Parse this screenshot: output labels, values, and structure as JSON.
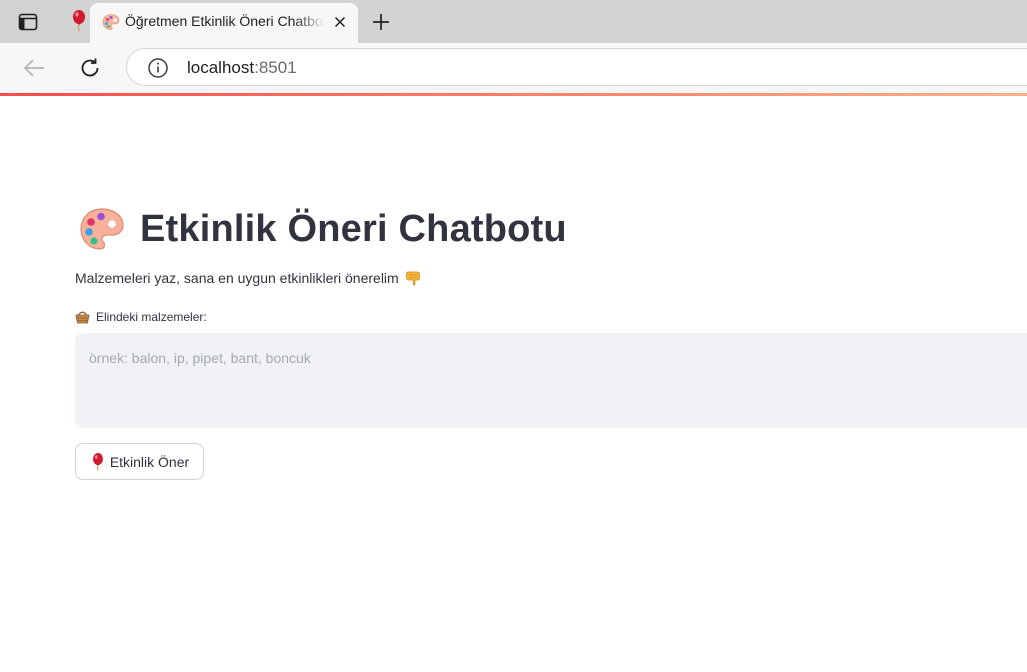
{
  "browser": {
    "tab": {
      "title": "Öğretmen Etkinlik Öneri Chatbotu"
    },
    "address": {
      "host": "localhost",
      "port": ":8501"
    }
  },
  "page": {
    "title": "Etkinlik Öneri Chatbotu",
    "subtitle": "Malzemeleri yaz, sana en uygun etkinlikleri önerelim",
    "input": {
      "label": "Elindeki malzemeler:",
      "placeholder": "örnek: balon, ip, pipet, bant, boncuk",
      "value": ""
    },
    "button": {
      "label": "Etkinlik Öner"
    }
  },
  "icons": {
    "sidebar": "sidebar-icon",
    "pinned_tab": "balloon-icon",
    "tab_favicon": "palette-icon",
    "close": "close-icon",
    "new_tab": "plus-icon",
    "back": "arrow-left-icon",
    "reload": "reload-icon",
    "site_info": "info-icon",
    "title": "palette-icon",
    "subtitle": "pointing-down-icon",
    "label": "basket-icon",
    "button": "balloon-icon"
  },
  "colors": {
    "accent_line_start": "#ff4b4b",
    "accent_line_end": "#fdb08a",
    "text": "#31333f",
    "input_bg": "#f0f2f6"
  }
}
